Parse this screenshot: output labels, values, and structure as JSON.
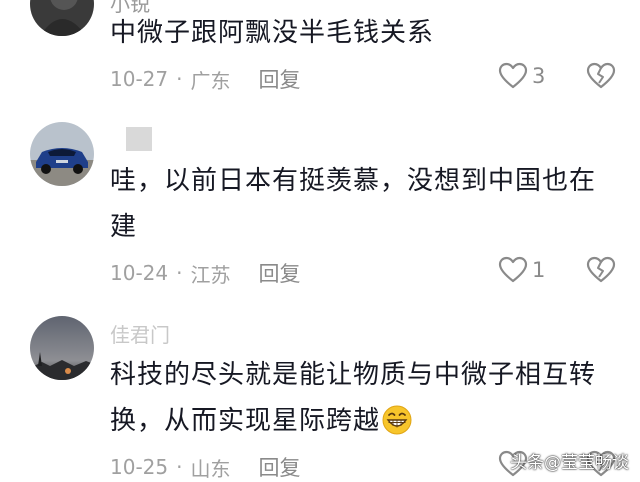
{
  "comments": [
    {
      "username": "小锐",
      "text": "中微子跟阿飘没半毛钱关系",
      "date": "10-27",
      "location": "广东",
      "reply_label": "回复",
      "likes": "3"
    },
    {
      "username": "",
      "text": "哇，以前日本有挺羡慕，没想到中国也在建",
      "date": "10-24",
      "location": "江苏",
      "reply_label": "回复",
      "likes": "1"
    },
    {
      "username": "佳君门",
      "text": "科技的尽头就是能让物质与中微子相互转换，从而实现星际跨越",
      "emoji": "grinning-face-emoji",
      "date": "10-25",
      "location": "山东",
      "reply_label": "回复",
      "likes": ""
    }
  ],
  "separator": "·",
  "watermark": "头条@莹莹畅谈",
  "colors": {
    "text": "#161823",
    "meta": "#a0a0a0",
    "icon": "#8a8a8a"
  }
}
